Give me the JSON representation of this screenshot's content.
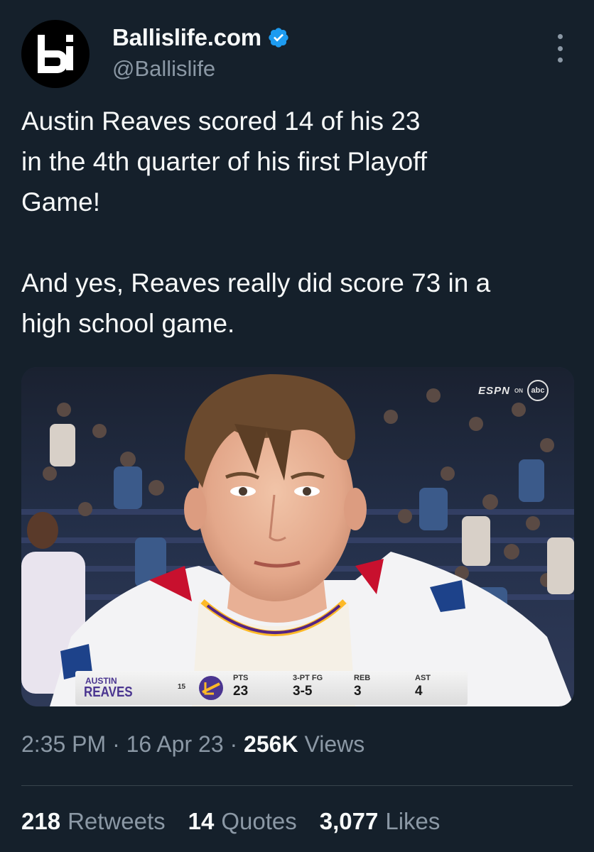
{
  "author": {
    "display_name": "Ballislife.com",
    "handle": "@Ballislife"
  },
  "tweet": {
    "text": "Austin Reaves scored 14 of his 23\nin the 4th quarter of his first Playoff\nGame!\n\nAnd yes, Reaves really did score 73 in a\nhigh school game."
  },
  "media": {
    "broadcast": {
      "network": "ESPN",
      "on": "ON",
      "channel": "abc"
    },
    "scorebug": {
      "first_name": "AUSTIN",
      "last_name": "REAVES",
      "jersey_number": "15",
      "stats": [
        {
          "label": "PTS",
          "value": "23"
        },
        {
          "label": "3-PT FG",
          "value": "3-5"
        },
        {
          "label": "REB",
          "value": "3"
        },
        {
          "label": "AST",
          "value": "4"
        }
      ]
    }
  },
  "meta": {
    "time": "2:35 PM",
    "separator": "·",
    "date": "16 Apr 23",
    "views_count": "256K",
    "views_label": "Views"
  },
  "engagement": {
    "retweets_count": "218",
    "retweets_label": "Retweets",
    "quotes_count": "14",
    "quotes_label": "Quotes",
    "likes_count": "3,077",
    "likes_label": "Likes"
  },
  "colors": {
    "background": "#15202b",
    "verified_blue": "#1d9bf0",
    "secondary_text": "#8b98a5",
    "lakers_purple": "#4a3590",
    "lakers_gold": "#fdb927"
  }
}
